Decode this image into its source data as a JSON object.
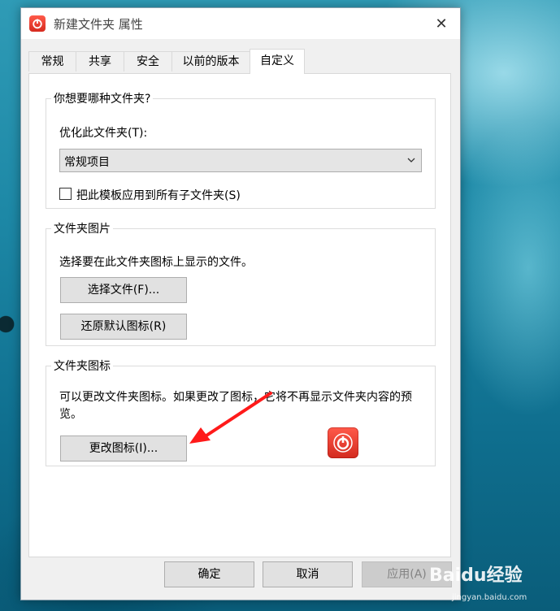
{
  "window": {
    "title": "新建文件夹 属性",
    "close_glyph": "✕"
  },
  "tabs": [
    {
      "label": "常规",
      "active": false
    },
    {
      "label": "共享",
      "active": false
    },
    {
      "label": "安全",
      "active": false
    },
    {
      "label": "以前的版本",
      "active": false
    },
    {
      "label": "自定义",
      "active": true
    }
  ],
  "folder_type": {
    "legend": "你想要哪种文件夹?",
    "optimize_label": "优化此文件夹(T):",
    "selected_value": "常规项目",
    "apply_subfolders_label": "把此模板应用到所有子文件夹(S)",
    "apply_subfolders_checked": false
  },
  "folder_picture": {
    "legend": "文件夹图片",
    "description": "选择要在此文件夹图标上显示的文件。",
    "choose_file_label": "选择文件(F)...",
    "restore_default_label": "还原默认图标(R)"
  },
  "folder_icon": {
    "legend": "文件夹图标",
    "description": "可以更改文件夹图标。如果更改了图标，它将不再显示文件夹内容的预览。",
    "change_icon_label": "更改图标(I)..."
  },
  "footer": {
    "ok_label": "确定",
    "cancel_label": "取消",
    "apply_label": "应用(A)"
  },
  "watermark": {
    "brand": "Baidu经验",
    "url": "jingyan.baidu.com"
  },
  "colors": {
    "accent_red": "#e0352a",
    "annotation_arrow": "#ff1a1a"
  },
  "icons": {
    "app": "power-icon",
    "preview": "power-icon"
  }
}
